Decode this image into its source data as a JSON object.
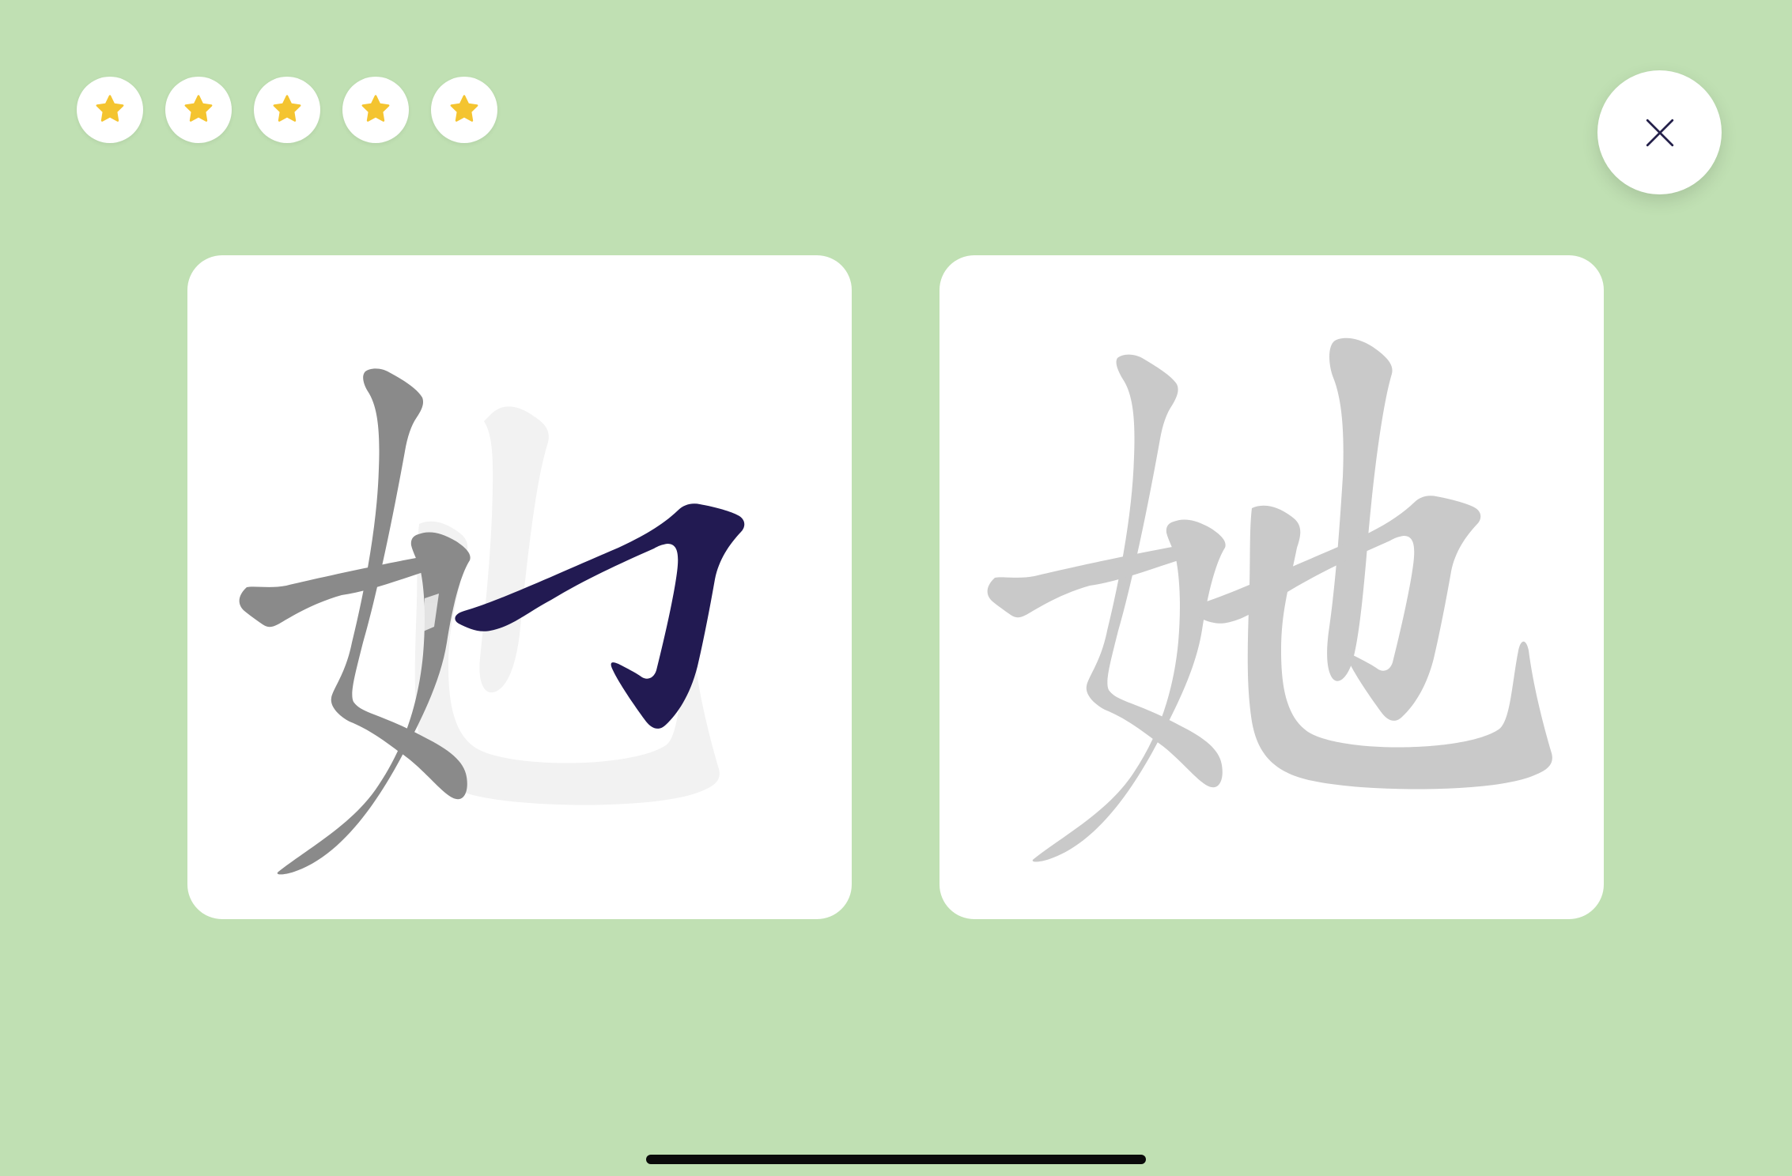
{
  "app": {
    "background_color": "#c0e0b3"
  },
  "progress": {
    "stars_total": 5,
    "stars_filled": 5,
    "star_color": "#f4c430",
    "star_icon": "star-icon"
  },
  "close_button": {
    "icon": "close-icon",
    "icon_color": "#24204a"
  },
  "practice_card": {
    "character": "她",
    "ghost_color": "#f2f2f2",
    "done_stroke_color": "#8a8a8a",
    "active_stroke_color": "#221a52"
  },
  "reference_card": {
    "character": "她",
    "glyph_color": "#c9c9c9"
  }
}
